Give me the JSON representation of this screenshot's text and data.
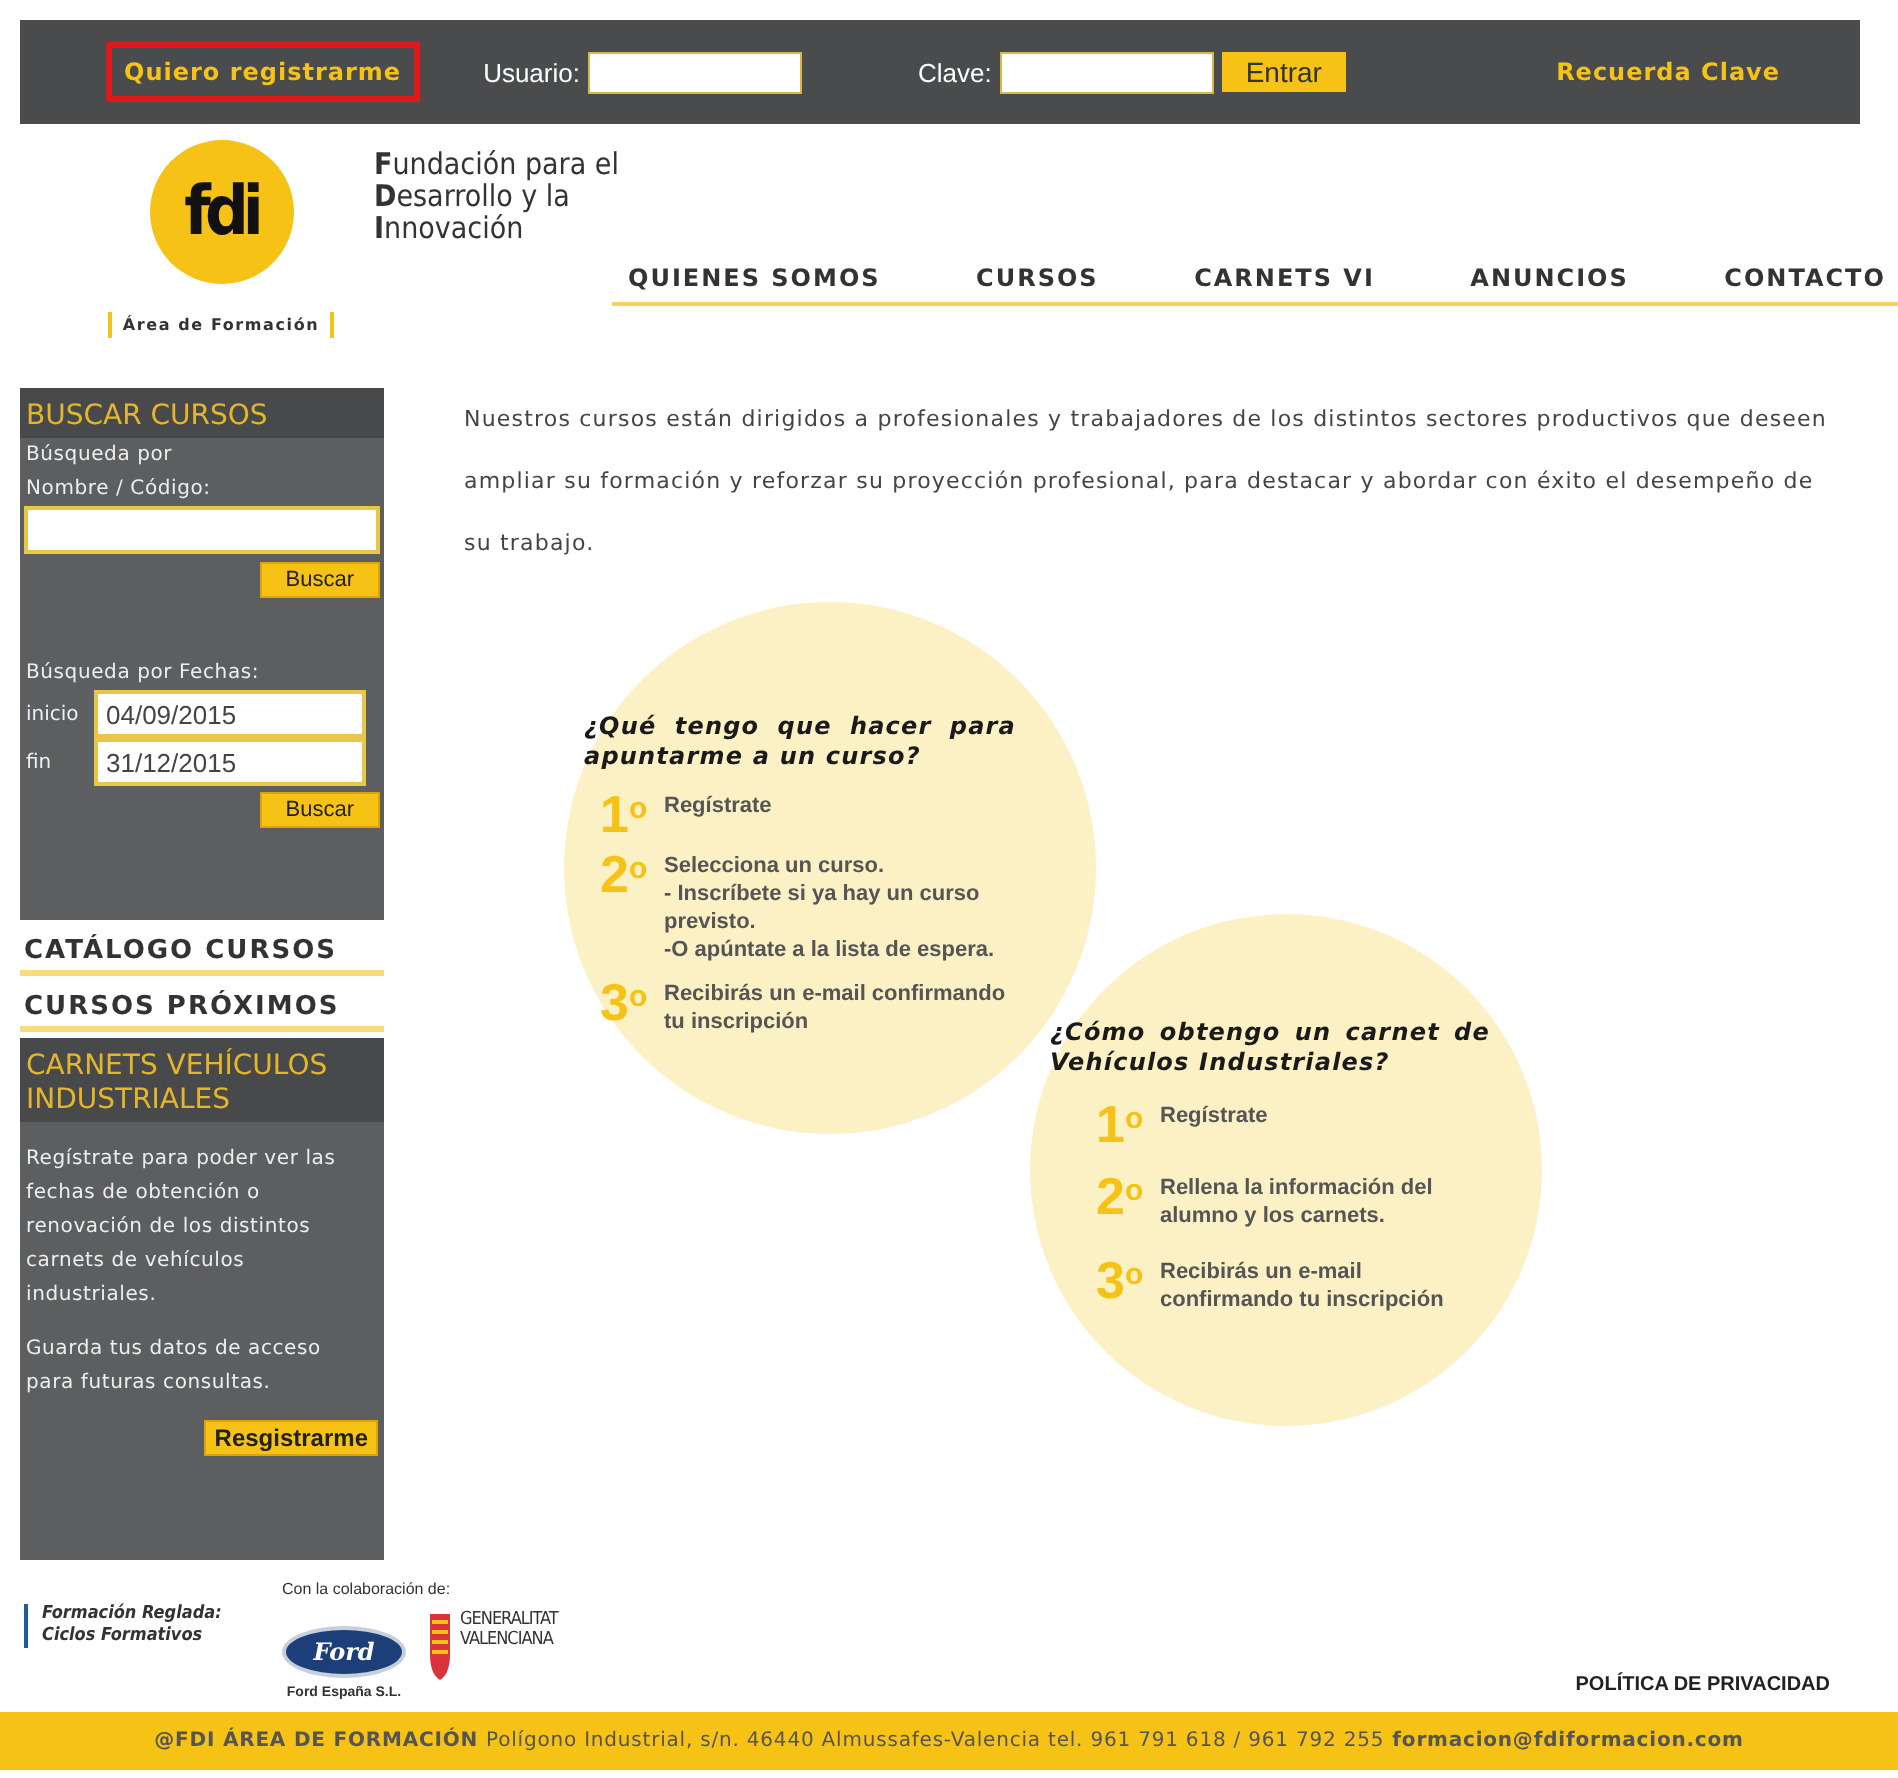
{
  "top_bar": {
    "register_link": "Quiero registrarme",
    "user_label": "Usuario:",
    "password_label": "Clave:",
    "login_button": "Entrar",
    "remember_link": "Recuerda Clave"
  },
  "logo": {
    "mark": "fdi",
    "subtitle": "Área de Formación",
    "title_lines": [
      "**F**undación para el",
      "**D**esarrollo y la",
      "**I**nnovación"
    ]
  },
  "nav": [
    {
      "label": "QUIENES SOMOS"
    },
    {
      "label": "CURSOS"
    },
    {
      "label": "CARNETS VI"
    },
    {
      "label": "ANUNCIOS"
    },
    {
      "label": "CONTACTO"
    }
  ],
  "sidebar": {
    "search_title": "BUSCAR CURSOS",
    "name_label": "Búsqueda por Nombre / Código:",
    "search_button": "Buscar",
    "date_label": "Búsqueda por Fechas:",
    "start_label": "inicio",
    "start_value": "04/09/2015",
    "end_label": "fin",
    "end_value": "31/12/2015",
    "date_button": "Buscar",
    "links": [
      "CATÁLOGO CURSOS",
      "CURSOS PRÓXIMOS"
    ],
    "vehicles_title": "CARNETS VEHÍCULOS INDUSTRIALES",
    "vehicles_paragraphs": [
      "Regístrate para poder ver las fechas de obtención o renovación de los distintos carnets de vehículos industriales.",
      "Guarda tus datos de acceso para futuras consultas."
    ],
    "vehicles_button": "Resgistrarme"
  },
  "intro": "Nuestros cursos están dirigidos a profesionales y trabajadores de los distintos sectores productivos que deseen ampliar su formación y reforzar su proyección profesional, para destacar y abordar con éxito el desempeño de su trabajo.",
  "circles": [
    {
      "question": "¿Qué tengo que hacer para apuntarme a un curso?",
      "steps": [
        {
          "number": "1",
          "ordinal": "o",
          "lines": [
            "Regístrate"
          ]
        },
        {
          "number": "2",
          "ordinal": "o",
          "lines": [
            "Selecciona un curso.",
            "- Inscríbete si ya hay un curso previsto.",
            "-O apúntate a la lista de espera."
          ]
        },
        {
          "number": "3",
          "ordinal": "o",
          "lines": [
            "Recibirás un e-mail confirmando tu inscripción"
          ]
        }
      ]
    },
    {
      "question": "¿Cómo obtengo un carnet de Vehículos Industriales?",
      "steps": [
        {
          "number": "1",
          "ordinal": "o",
          "lines": [
            "Regístrate"
          ]
        },
        {
          "number": "2",
          "ordinal": "o",
          "lines": [
            "Rellena la información del alumno y los carnets."
          ]
        },
        {
          "number": "3",
          "ordinal": "o",
          "lines": [
            "Recibirás un e-mail confirmando tu inscripción"
          ]
        }
      ]
    }
  ],
  "footer": {
    "regulated": "Formación Reglada: Ciclos Formativos",
    "collab_label": "Con la colaboración de:",
    "ford_mark": "Ford",
    "ford_caption": "Ford España S.L.",
    "gva_name": "GENERALITAT VALENCIANA",
    "privacy_link": "POLÍTICA DE PRIVACIDAD",
    "address_bold": "@FDI ÁREA DE FORMACIÓN",
    "address": "Polígono Industrial, s/n. 46440 Almussafes-Valencia tel. 961 791 618 / 961 792 255",
    "email": "formacion@fdiformacion.com"
  }
}
